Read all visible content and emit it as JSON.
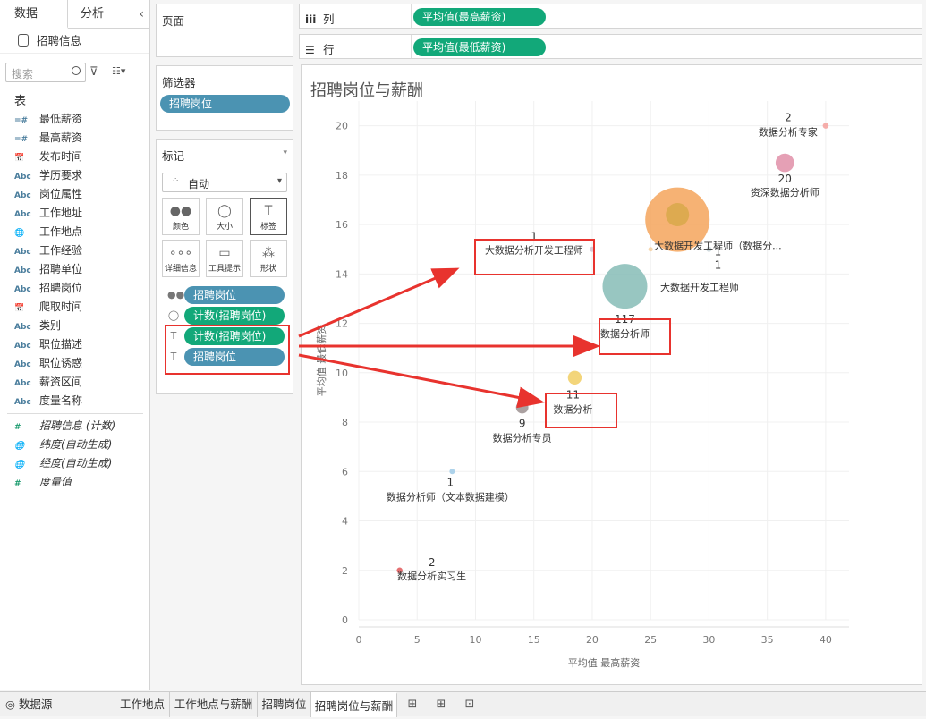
{
  "data_pane": {
    "tabs": [
      "数据",
      "分析"
    ],
    "collapse_glyph": "‹",
    "datasource": "招聘信息",
    "search_placeholder": "搜索",
    "section_title": "表",
    "fields": [
      {
        "type": "=#",
        "name": "最低薪资"
      },
      {
        "type": "=#",
        "name": "最高薪资"
      },
      {
        "type": "📅",
        "name": "发布时间"
      },
      {
        "type": "Abc",
        "name": "学历要求"
      },
      {
        "type": "Abc",
        "name": "岗位属性"
      },
      {
        "type": "Abc",
        "name": "工作地址"
      },
      {
        "type": "🌐",
        "name": "工作地点"
      },
      {
        "type": "Abc",
        "name": "工作经验"
      },
      {
        "type": "Abc",
        "name": "招聘单位"
      },
      {
        "type": "Abc",
        "name": "招聘岗位"
      },
      {
        "type": "📅",
        "name": "爬取时间"
      },
      {
        "type": "Abc",
        "name": "类别"
      },
      {
        "type": "Abc",
        "name": "职位描述"
      },
      {
        "type": "Abc",
        "name": "职位诱惑"
      },
      {
        "type": "Abc",
        "name": "薪资区间"
      },
      {
        "type": "Abc",
        "name": "度量名称"
      }
    ],
    "measures": [
      {
        "type": "#",
        "name": "招聘信息 (计数)"
      },
      {
        "type": "🌐",
        "name": "纬度(自动生成)"
      },
      {
        "type": "🌐",
        "name": "经度(自动生成)"
      },
      {
        "type": "#",
        "name": "度量值"
      }
    ]
  },
  "pages_title": "页面",
  "filters": {
    "title": "筛选器",
    "pill": "招聘岗位"
  },
  "marks": {
    "title": "标记",
    "type": "自动",
    "buttons": [
      "颜色",
      "大小",
      "标签",
      "详细信息",
      "工具提示",
      "形状"
    ],
    "pills": [
      "招聘岗位",
      "计数(招聘岗位)",
      "计数(招聘岗位)",
      "招聘岗位"
    ]
  },
  "columns": {
    "label": "列",
    "pill": "平均值(最高薪资)"
  },
  "rows": {
    "label": "行",
    "pill": "平均值(最低薪资)"
  },
  "chart_data": {
    "type": "scatter",
    "title": "招聘岗位与薪酬",
    "xlabel": "平均值 最高薪资",
    "ylabel": "平均值 最低薪资",
    "xlim": [
      0,
      42
    ],
    "ylim": [
      0,
      21
    ],
    "xticks": [
      0,
      5,
      10,
      15,
      20,
      25,
      30,
      35,
      40
    ],
    "yticks": [
      0,
      2,
      4,
      6,
      8,
      10,
      12,
      14,
      16,
      18,
      20
    ],
    "points": [
      {
        "name": "数据分析专家",
        "x": 40,
        "y": 20,
        "count": 2,
        "color": "#f4a09c"
      },
      {
        "name": "资深数据分析师",
        "x": 36.5,
        "y": 18.5,
        "count": 20,
        "color": "#e08fa8"
      },
      {
        "name": "大数据开发工程师",
        "x": 27.3,
        "y": 16.2,
        "count": null,
        "color": "#f5a55c"
      },
      {
        "name": "",
        "x": 27.3,
        "y": 16.4,
        "count": null,
        "color": "#d8a84a"
      },
      {
        "name": "大数据分析开发工程师",
        "x": 20,
        "y": 15,
        "count": 1,
        "color": "#d4c2d0"
      },
      {
        "name": "",
        "x": 25,
        "y": 15,
        "count": null,
        "color": "#f5cfa0"
      },
      {
        "name": "大数据开发工程师（数据分...",
        "x": 30,
        "y": 15,
        "count": 1,
        "color": "#c8d3d8"
      },
      {
        "name": "数据分析师",
        "x": 22.8,
        "y": 13.5,
        "count": 117,
        "color": "#86bcb6"
      },
      {
        "name": "数据分析",
        "x": 18.5,
        "y": 9.8,
        "count": 11,
        "color": "#f1ce63"
      },
      {
        "name": "数据分析专员",
        "x": 14,
        "y": 8.6,
        "count": 9,
        "color": "#9c9090"
      },
      {
        "name": "数据分析师（文本数据建模）",
        "x": 8,
        "y": 6,
        "count": 1,
        "color": "#a0cbe8"
      },
      {
        "name": "数据分析实习生",
        "x": 3.5,
        "y": 2,
        "count": 2,
        "color": "#e15759"
      }
    ]
  },
  "bottom_tabs": [
    "数据源",
    "工作地点",
    "工作地点与薪酬",
    "招聘岗位",
    "招聘岗位与薪酬"
  ],
  "tab_glyphs": {
    "datasource": "◎",
    "new_sheet": "⊞",
    "new_dashboard": "⊞",
    "new_story": "⊡"
  },
  "tool_glyphs": {
    "filter": "⊽",
    "view": "☷▾",
    "dropdown": "▾"
  },
  "mark_button_glyphs": [
    "●●",
    "◯",
    "T",
    "∘∘∘",
    "▭",
    "⁂"
  ],
  "mark_row_glyphs": [
    "●●",
    "◯",
    "T",
    "T"
  ]
}
